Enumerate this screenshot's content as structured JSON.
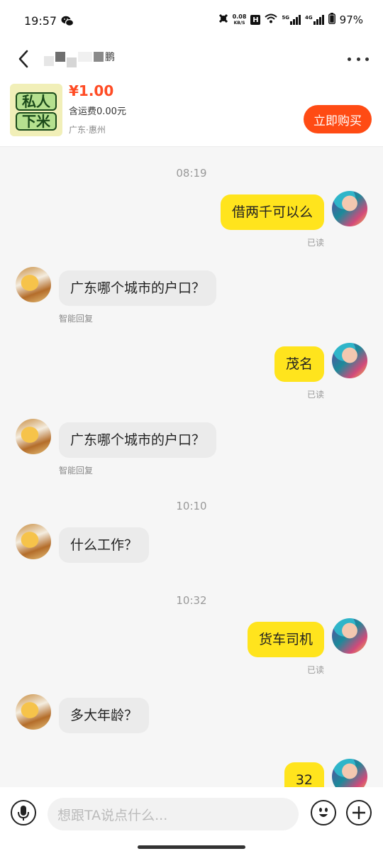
{
  "status_bar": {
    "time": "19:57",
    "network_speed_value": "0.08",
    "network_speed_unit": "KB/S",
    "hd_badge": "H",
    "signal_5g": "5G",
    "signal_4g": "4G",
    "battery": "97%"
  },
  "header": {
    "contact_name_suffix": "鹏",
    "back_icon": "chevron-left-icon",
    "more_icon": "more-dots-icon"
  },
  "product": {
    "thumb_line1": "私人",
    "thumb_line2": "下米",
    "price": "¥1.00",
    "shipping": "含运费0.00元",
    "location": "广东·惠州",
    "buy_label": "立即购买",
    "accent_color": "#ff4b14"
  },
  "messages": [
    {
      "type": "time",
      "text": "08:19"
    },
    {
      "type": "self",
      "text": "借两千可以么",
      "status": "已读"
    },
    {
      "type": "other",
      "text": "广东哪个城市的户口？",
      "note": "智能回复"
    },
    {
      "type": "self",
      "text": "茂名",
      "status": "已读"
    },
    {
      "type": "other",
      "text": "广东哪个城市的户口？",
      "note": "智能回复"
    },
    {
      "type": "time",
      "text": "10:10"
    },
    {
      "type": "other",
      "text": "什么工作？"
    },
    {
      "type": "time",
      "text": "10:32"
    },
    {
      "type": "self",
      "text": "货车司机",
      "status": "已读"
    },
    {
      "type": "other",
      "text": "多大年龄？"
    },
    {
      "type": "self",
      "text": "32"
    }
  ],
  "input_bar": {
    "placeholder": "想跟TA说点什么...",
    "mic_icon": "microphone-icon",
    "emoji_icon": "emoji-icon",
    "plus_icon": "plus-icon"
  },
  "colors": {
    "self_bubble": "#ffe41d",
    "other_bubble": "#ebebeb",
    "price": "#ff4b24"
  }
}
